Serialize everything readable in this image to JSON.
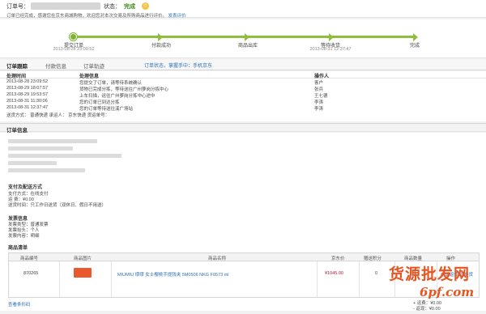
{
  "status_bar": {
    "order_no_label": "订单号：",
    "status_label": "状态：",
    "status_value": "完成",
    "notice_text": "订单已经完成，感谢您在京东商城购物，欢迎您对本次交易及所购商品进行评价。",
    "notice_link": "发表评价"
  },
  "progress": {
    "steps": [
      {
        "label": "提交订单",
        "time": "2013-08-28 23:09:52"
      },
      {
        "label": "付款成功",
        "time": ""
      },
      {
        "label": "商品出库",
        "time": ""
      },
      {
        "label": "等待收货",
        "time": "2013-08-31 12:37:47"
      },
      {
        "label": "完成",
        "time": ""
      }
    ]
  },
  "tabs": {
    "items": [
      "订单跟踪",
      "付款信息",
      "订单轨迹"
    ],
    "notice": "订单状态，掌握手中：手机京东"
  },
  "log": {
    "headers": [
      "处理时间",
      "处理信息",
      "操作人"
    ],
    "rows": [
      {
        "time": "2013-08-28 23:09:52",
        "info": "您提交了订单，请等待系统确认",
        "op": "客户"
      },
      {
        "time": "2013-08-29 18:07:57",
        "info": "货物已完成分拣，等待送往广州萝岗分拣中心",
        "op": "张兵"
      },
      {
        "time": "2013-08-29 19:53:57",
        "info": "上车扫描，运往广州萝岗分拣中心途中",
        "op": "王七德"
      },
      {
        "time": "2013-08-31 11:30:06",
        "info": "您的订单已到达分拣",
        "op": "李涛"
      },
      {
        "time": "2013-08-31 12:37:47",
        "info": "您的订单等待送往溪广场站",
        "op": "李涛"
      }
    ],
    "shipping": "送货方式：  普通快递        承运人：  京东快递        货运单号："
  },
  "order_info": {
    "title": "订单信息",
    "payment_title": "支付及配送方式",
    "payment_lines": [
      "支付方式：在线支付",
      "运     费：¥0.00",
      "送货时间：只工作日送货（双休日、假日不用送）"
    ],
    "invoice_title": "发票信息",
    "invoice_lines": [
      "发票类型：普通发票",
      "发票抬头：个人",
      "发票内容：明细"
    ]
  },
  "goods": {
    "title": "商品清单",
    "headers": [
      "商品编号",
      "商品图片",
      "商品名称",
      "京东价",
      "赠送积分",
      "商品数量",
      "操作"
    ],
    "row": {
      "id": "870265",
      "name": "MIUMIU 缪缪 女士樱桃手提钱夹 5M0506 NKG F0573 ml",
      "price": "¥1045.00",
      "points": "0",
      "qty": "1",
      "action": "申请返修/退换货"
    },
    "barcode_link": "查看条形码",
    "totals": [
      "+ 运费：¥0.00",
      "- 返现：¥0.00"
    ]
  },
  "watermark": {
    "cn": "货源批发网",
    "url": "6pf.com"
  },
  "colors": {
    "accent_green": "#7cb22f",
    "link_blue": "#2a6fb8",
    "price_red": "#c8102e",
    "watermark_orange": "#e8541f"
  }
}
